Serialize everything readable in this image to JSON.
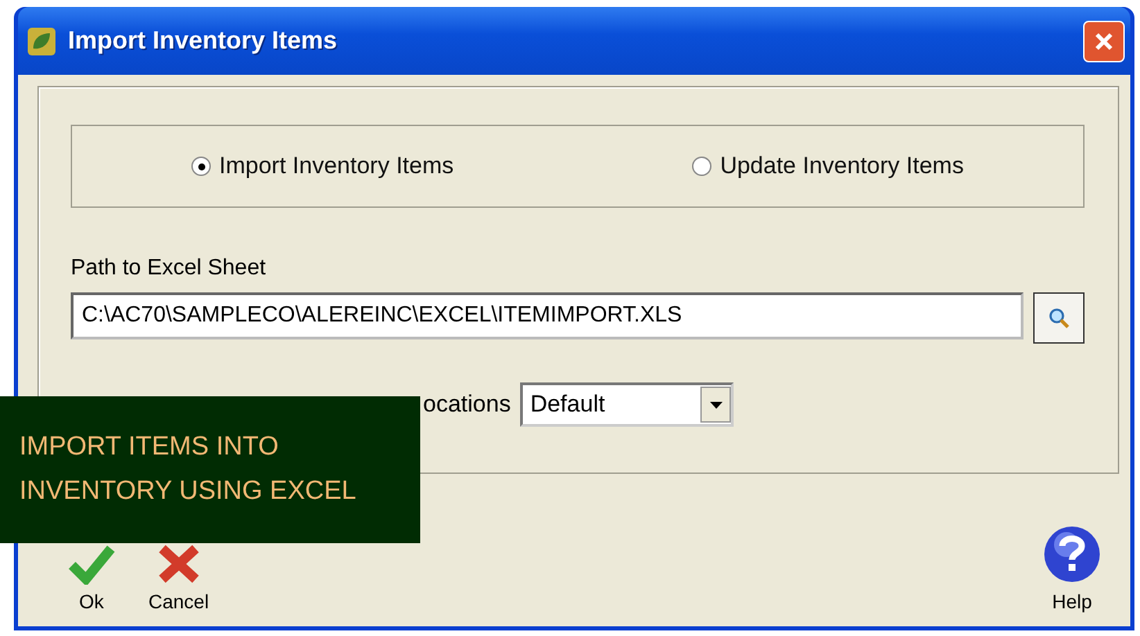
{
  "window": {
    "title": "Import Inventory Items"
  },
  "modes": [
    {
      "label": "Import Inventory Items",
      "selected": true
    },
    {
      "label": "Update Inventory Items",
      "selected": false
    }
  ],
  "path": {
    "label": "Path to Excel Sheet",
    "value": "C:\\AC70\\SAMPLECO\\ALEREINC\\EXCEL\\ITEMIMPORT.XLS"
  },
  "locations": {
    "label": "ocations",
    "value": "Default"
  },
  "buttons": [
    {
      "label": "Ok",
      "kind": "ok"
    },
    {
      "label": "Cancel",
      "kind": "cancel"
    }
  ],
  "help": {
    "label": "Help"
  },
  "caption": [
    "IMPORT ITEMS INTO",
    "INVENTORY USING EXCEL"
  ]
}
